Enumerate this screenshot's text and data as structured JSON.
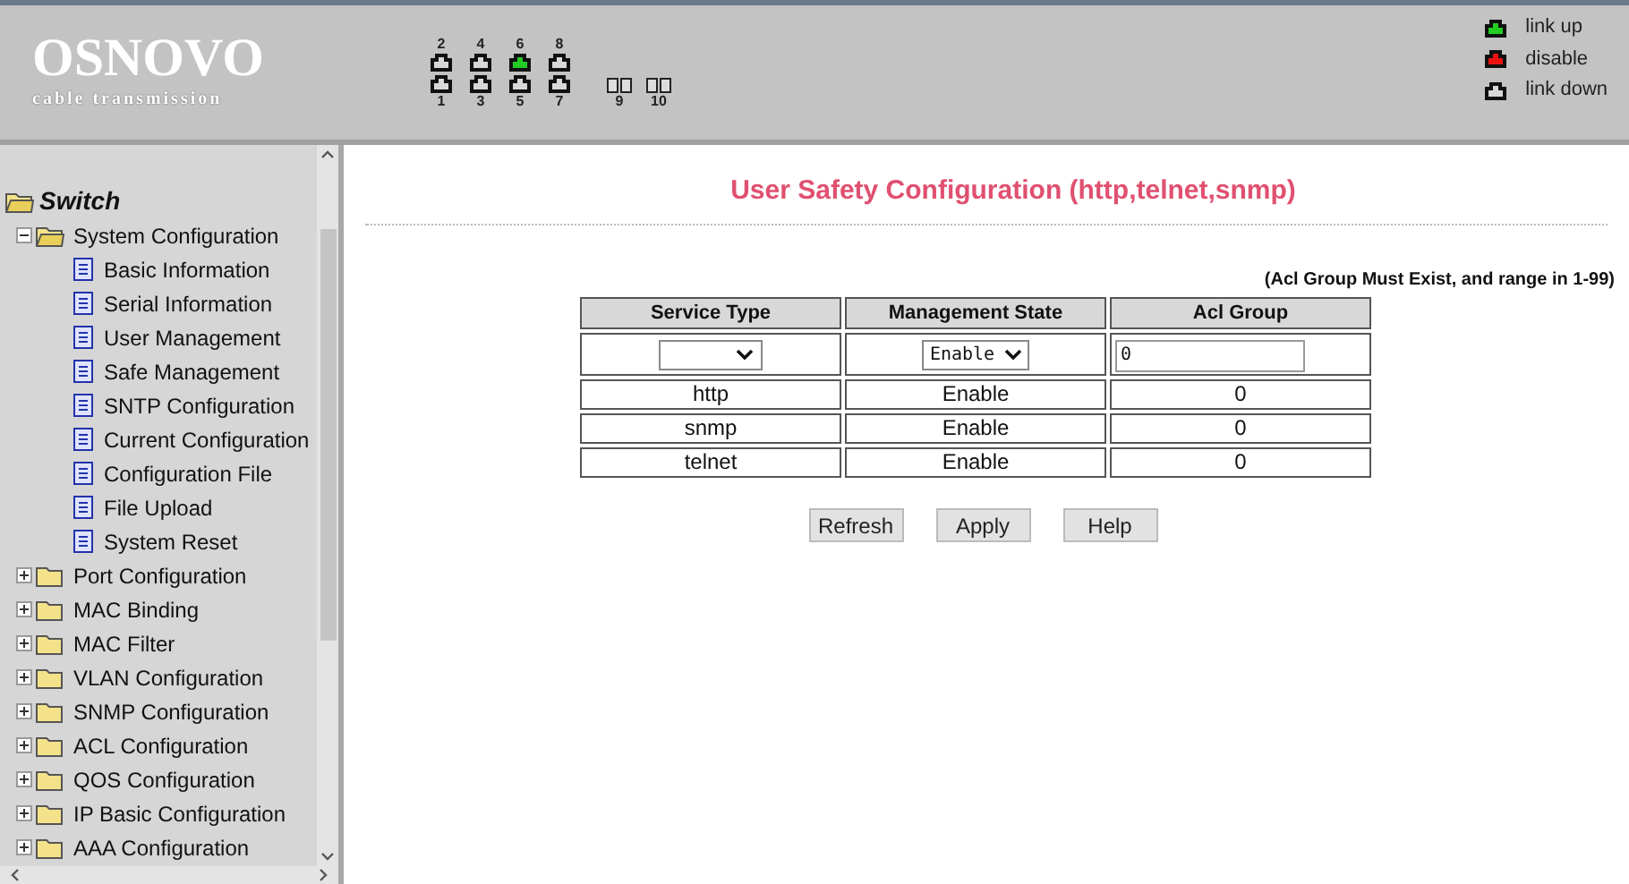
{
  "logo": {
    "name": "OSNOVO",
    "tagline": "cable transmission"
  },
  "ports": [
    {
      "label": "2",
      "color": "#d8d8d8"
    },
    {
      "label": "4",
      "color": "#d8d8d8"
    },
    {
      "label": "6",
      "color": "#22cc22"
    },
    {
      "label": "8",
      "color": "#d8d8d8"
    },
    {
      "label": "1",
      "color": "#d8d8d8"
    },
    {
      "label": "3",
      "color": "#d8d8d8"
    },
    {
      "label": "5",
      "color": "#d8d8d8"
    },
    {
      "label": "7",
      "color": "#d8d8d8"
    }
  ],
  "sfp_ports": [
    {
      "label": "9"
    },
    {
      "label": "10"
    }
  ],
  "legend": [
    {
      "color": "#22cc22",
      "label": "link up"
    },
    {
      "color": "#ee1111",
      "label": "disable"
    },
    {
      "color": "#d8d8d8",
      "label": "link down"
    }
  ],
  "tree": {
    "root": "Switch",
    "children": [
      {
        "label": "System Configuration",
        "expanded": true,
        "children": [
          {
            "label": "Basic Information"
          },
          {
            "label": "Serial Information"
          },
          {
            "label": "User Management"
          },
          {
            "label": "Safe Management"
          },
          {
            "label": "SNTP Configuration"
          },
          {
            "label": "Current Configuration"
          },
          {
            "label": "Configuration File"
          },
          {
            "label": "File Upload"
          },
          {
            "label": "System Reset"
          }
        ]
      },
      {
        "label": "Port Configuration",
        "expanded": false
      },
      {
        "label": "MAC Binding",
        "expanded": false
      },
      {
        "label": "MAC Filter",
        "expanded": false
      },
      {
        "label": "VLAN Configuration",
        "expanded": false
      },
      {
        "label": "SNMP Configuration",
        "expanded": false
      },
      {
        "label": "ACL Configuration",
        "expanded": false
      },
      {
        "label": "QOS Configuration",
        "expanded": false
      },
      {
        "label": "IP Basic Configuration",
        "expanded": false
      },
      {
        "label": "AAA Configuration",
        "expanded": false
      }
    ]
  },
  "page_title": "User Safety Configuration (http,telnet,snmp)",
  "note": "(Acl Group Must Exist, and range in 1-99)",
  "table": {
    "columns": [
      "Service Type",
      "Management State",
      "Acl Group"
    ],
    "form": {
      "management_state": "Enable",
      "acl_group": "0"
    },
    "rows": [
      [
        "http",
        "Enable",
        "0"
      ],
      [
        "snmp",
        "Enable",
        "0"
      ],
      [
        "telnet",
        "Enable",
        "0"
      ]
    ]
  },
  "buttons": [
    "Refresh",
    "Apply",
    "Help"
  ]
}
